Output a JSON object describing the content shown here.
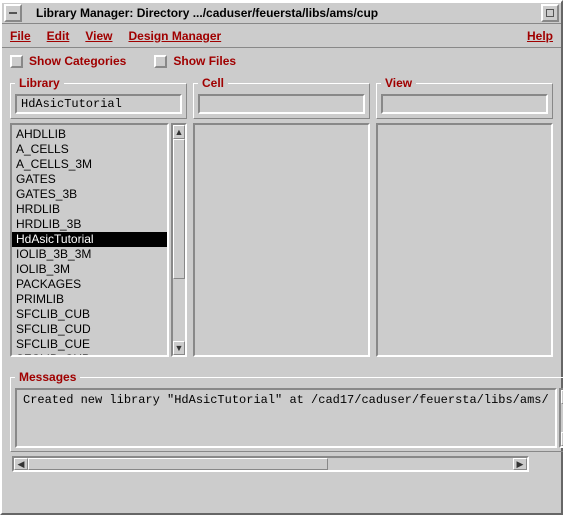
{
  "title": "Library Manager: Directory .../caduser/feuersta/libs/ams/cup",
  "menu": {
    "file": "File",
    "edit": "Edit",
    "view": "View",
    "design_manager": "Design Manager",
    "help": "Help"
  },
  "checks": {
    "show_categories": "Show Categories",
    "show_files": "Show Files"
  },
  "columns": {
    "library": {
      "label": "Library",
      "value": "HdAsicTutorial"
    },
    "cell": {
      "label": "Cell",
      "value": ""
    },
    "view": {
      "label": "View",
      "value": ""
    }
  },
  "library_items": [
    "AHDLLIB",
    "A_CELLS",
    "A_CELLS_3M",
    "GATES",
    "GATES_3B",
    "HRDLIB",
    "HRDLIB_3B",
    "HdAsicTutorial",
    "IOLIB_3B_3M",
    "IOLIB_3M",
    "PACKAGES",
    "PRIMLIB",
    "SFCLIB_CUB",
    "SFCLIB_CUD",
    "SFCLIB_CUE",
    "SFCLIB_CUP"
  ],
  "library_selected": "HdAsicTutorial",
  "messages": {
    "label": "Messages",
    "text": "Created new library \"HdAsicTutorial\" at /cad17/caduser/feuersta/libs/ams/"
  }
}
